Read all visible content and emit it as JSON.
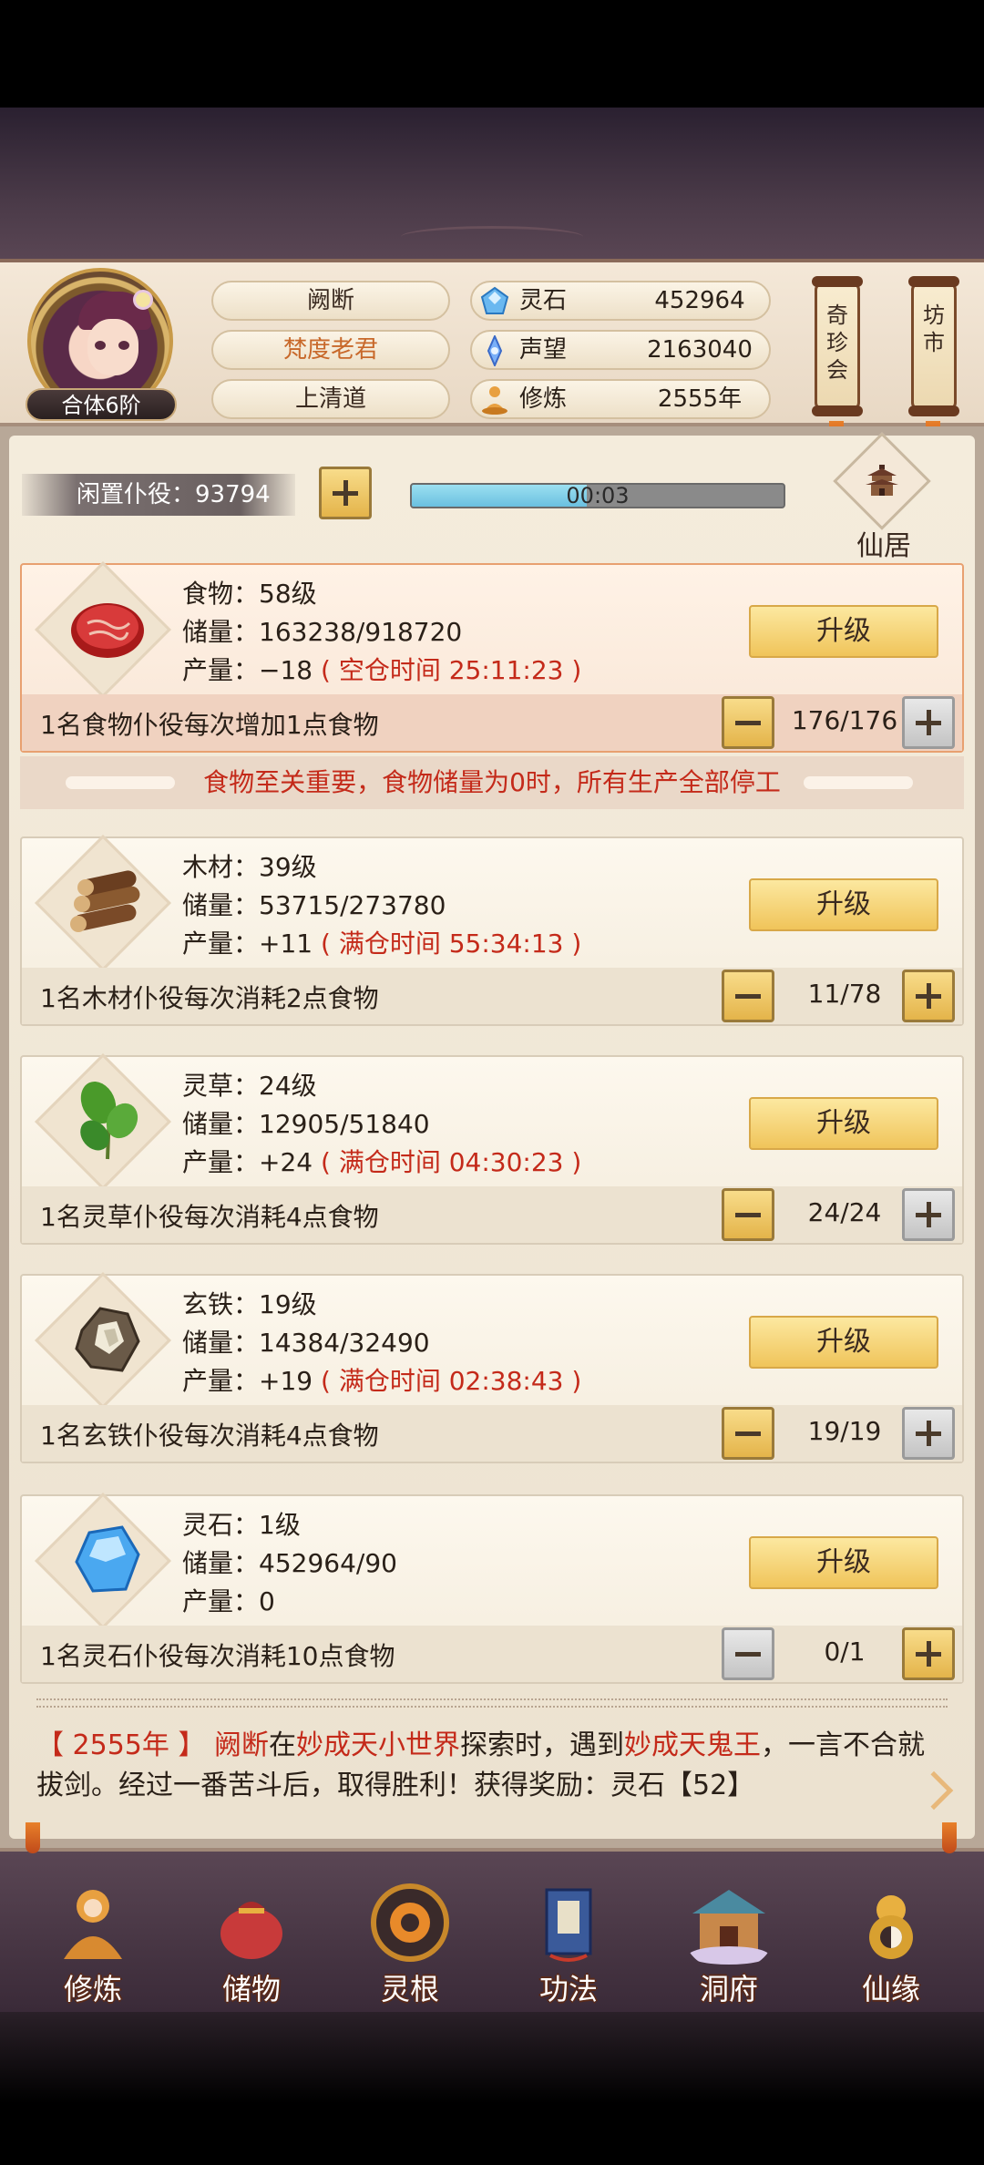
{
  "profile": {
    "rank": "合体6阶",
    "name": "阙断",
    "title": "梵度老君",
    "sect": "上清道"
  },
  "resources": [
    {
      "icon": "spirit-stone-icon",
      "label": "灵石",
      "value": "452964"
    },
    {
      "icon": "prestige-icon",
      "label": "声望",
      "value": "2163040"
    },
    {
      "icon": "cultivation-icon",
      "label": "修炼",
      "value": "2555年"
    }
  ],
  "banners": {
    "treasure": "奇珍会",
    "market": "坊市"
  },
  "idle": {
    "label": "闲置仆役：93794",
    "timer": "00:03",
    "progress": 0.47
  },
  "residence": {
    "label": "仙居"
  },
  "cards": [
    {
      "line1": "食物：58级",
      "line2": "储量：163238/918720",
      "line3_a": "产量：−18",
      "line3_b": "( 空仓时间 25:11:23 )",
      "upgrade": "升级",
      "desc": "1名食物仆役每次增加1点食物",
      "count": "176/176"
    },
    {
      "line1": "木材：39级",
      "line2": "储量：53715/273780",
      "line3_a": "产量：+11",
      "line3_b": "( 满仓时间 55:34:13 )",
      "upgrade": "升级",
      "desc": "1名木材仆役每次消耗2点食物",
      "count": "11/78"
    },
    {
      "line1": "灵草：24级",
      "line2": "储量：12905/51840",
      "line3_a": "产量：+24",
      "line3_b": "( 满仓时间 04:30:23 )",
      "upgrade": "升级",
      "desc": "1名灵草仆役每次消耗4点食物",
      "count": "24/24"
    },
    {
      "line1": "玄铁：19级",
      "line2": "储量：14384/32490",
      "line3_a": "产量：+19",
      "line3_b": "( 满仓时间 02:38:43 )",
      "upgrade": "升级",
      "desc": "1名玄铁仆役每次消耗4点食物",
      "count": "19/19"
    },
    {
      "line1": "灵石：1级",
      "line2": "储量：452964/90",
      "line3_a": "产量：0",
      "line3_b": "",
      "upgrade": "升级",
      "desc": "1名灵石仆役每次消耗10点食物",
      "count": "0/1"
    }
  ],
  "warning": "食物至关重要，食物储量为0时，所有生产全部停工",
  "log": {
    "open": "【",
    "year": "2555年",
    "close": "】",
    "name": "阙断",
    "t1": "在",
    "place": "妙成天小世界",
    "t2": "探索时，遇到",
    "enemy": "妙成天鬼王",
    "t3": "，一言不合就拔剑。经过一番苦斗后，取得胜利！获得奖励：灵石【52】"
  },
  "nav": [
    "修炼",
    "储物",
    "灵根",
    "功法",
    "洞府",
    "仙缘"
  ],
  "colors": {
    "accent_red": "#c42a1a",
    "gold": "#f0c45a",
    "progress": "#6ac0e0"
  }
}
